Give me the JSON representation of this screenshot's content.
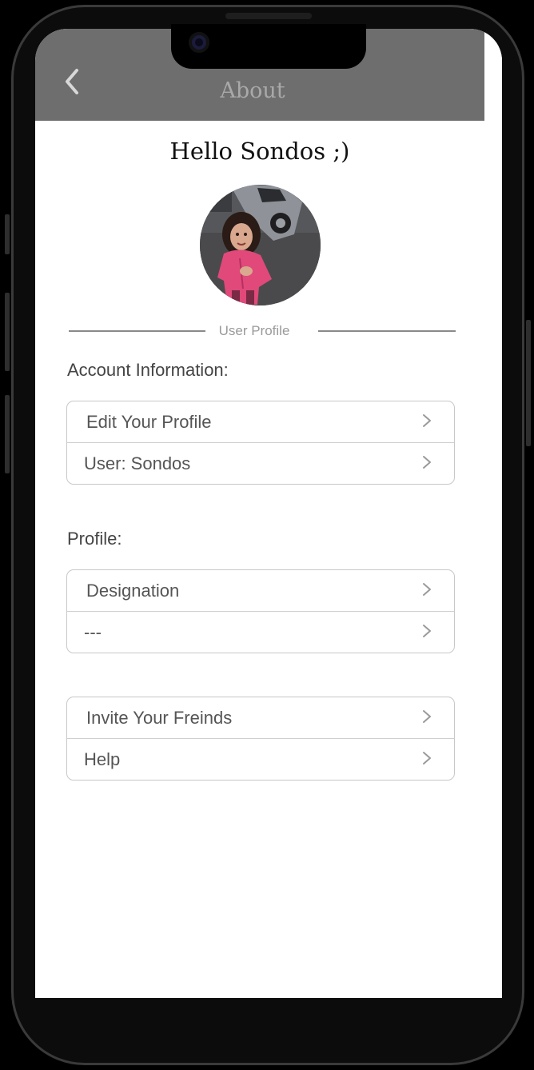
{
  "header": {
    "title": "About",
    "background": "#6e6e6e",
    "back_icon": "chevron-left-icon"
  },
  "greeting": "Hello Sondos ;)",
  "avatar": {
    "description_icon": "profile-photo"
  },
  "divider": {
    "label": "User Profile"
  },
  "sections": {
    "account": {
      "label": "Account Information:",
      "rows": [
        {
          "label": "Edit Your Profile"
        },
        {
          "label": "User: Sondos"
        }
      ]
    },
    "profile": {
      "label": "Profile:",
      "rows": [
        {
          "label": "Designation"
        },
        {
          "label": "---"
        }
      ]
    },
    "more": {
      "rows": [
        {
          "label": "Invite Your Freinds"
        },
        {
          "label": "Help"
        }
      ]
    }
  },
  "row_icon": "chevron-right-icon"
}
